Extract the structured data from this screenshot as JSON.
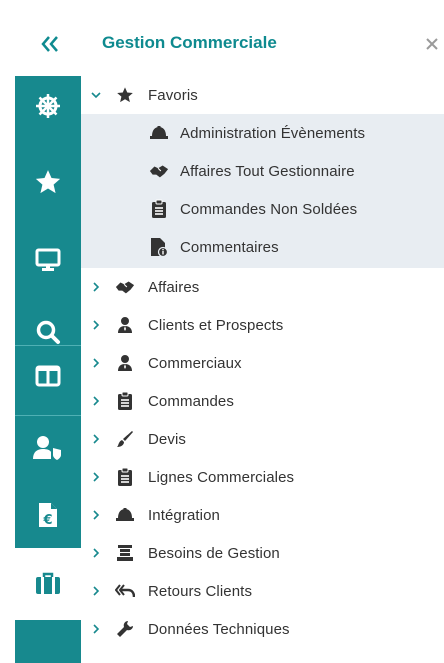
{
  "header": {
    "collapse_icon": "double-chevron-left-icon",
    "title": "Gestion Commerciale",
    "close_icon": "close-icon"
  },
  "colors": {
    "accent": "#17898e",
    "title": "#0e8a8f",
    "highlight_bg": "#e8edf2",
    "icon_dark": "#333333"
  },
  "sidebar": {
    "items": [
      {
        "icon": "ship-wheel-icon"
      },
      {
        "icon": "star-icon"
      },
      {
        "icon": "monitor-icon"
      },
      {
        "icon": "search-icon"
      },
      {
        "icon": "columns-icon"
      },
      {
        "icon": "user-shield-icon"
      },
      {
        "icon": "euro-document-icon"
      },
      {
        "icon": "briefcase-icon",
        "active": true
      }
    ]
  },
  "tree": {
    "favorites": {
      "label": "Favoris",
      "icon": "star-icon",
      "expanded": true,
      "children": [
        {
          "label": "Administration Évènements",
          "icon": "hard-hat-icon"
        },
        {
          "label": "Affaires Tout Gestionnaire",
          "icon": "handshake-icon"
        },
        {
          "label": "Commandes Non Soldées",
          "icon": "clipboard-icon"
        },
        {
          "label": "Commentaires",
          "icon": "file-info-icon"
        }
      ]
    },
    "items": [
      {
        "label": "Affaires",
        "icon": "handshake-icon"
      },
      {
        "label": "Clients et Prospects",
        "icon": "user-tie-icon"
      },
      {
        "label": "Commerciaux",
        "icon": "user-tie-icon"
      },
      {
        "label": "Commandes",
        "icon": "clipboard-icon"
      },
      {
        "label": "Devis",
        "icon": "brush-icon"
      },
      {
        "label": "Lignes Commerciales",
        "icon": "clipboard-icon"
      },
      {
        "label": "Intégration",
        "icon": "hard-hat-icon"
      },
      {
        "label": "Besoins de Gestion",
        "icon": "stack-icon"
      },
      {
        "label": "Retours Clients",
        "icon": "return-icon"
      },
      {
        "label": "Données Techniques",
        "icon": "wrench-icon"
      }
    ]
  }
}
